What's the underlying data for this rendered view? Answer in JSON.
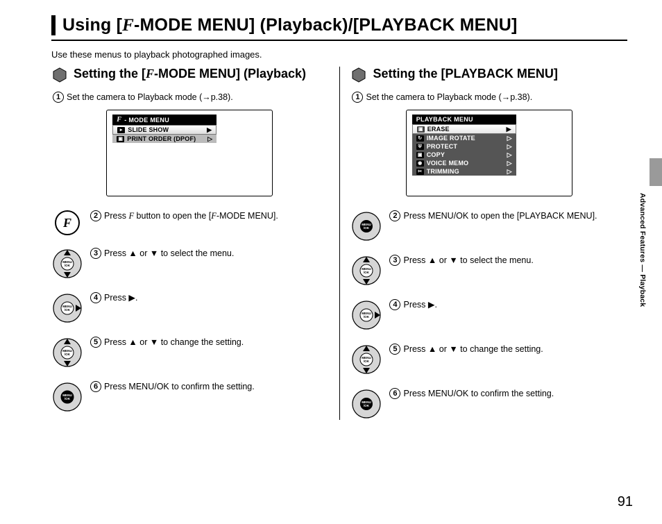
{
  "title_part1": "Using [",
  "title_f": "F",
  "title_part2": "-MODE MENU] (Playback)/[PLAYBACK MENU]",
  "intro": "Use these menus to playback photographed images.",
  "side_label": "Advanced Features — Playback",
  "page_number": "91",
  "left": {
    "heading_part1": "Setting the [",
    "heading_f": "F",
    "heading_part2": "-MODE MENU] (Playback)",
    "step1_num": "1",
    "step1_text": "Set the camera to Playback mode (→p.38).",
    "lcd": {
      "header_f": "F",
      "header_rest": "- MODE MENU",
      "row1_label": "SLIDE SHOW",
      "row2_label": "PRINT ORDER (DPOF)"
    },
    "steps": [
      {
        "num": "2",
        "pre": "Press ",
        "f": "F",
        "post": " button to open the [",
        "f2": "F",
        "post2": "-MODE MENU]."
      },
      {
        "num": "3",
        "text": "Press ▲ or ▼ to select the menu."
      },
      {
        "num": "4",
        "text": "Press ▶."
      },
      {
        "num": "5",
        "text": "Press ▲ or ▼ to change the setting."
      },
      {
        "num": "6",
        "text": "Press MENU/OK to confirm the setting."
      }
    ]
  },
  "right": {
    "heading": "Setting the [PLAYBACK MENU]",
    "step1_num": "1",
    "step1_text": "Set the camera to Playback mode (→p.38).",
    "lcd": {
      "header": "PLAYBACK MENU",
      "rows": [
        "ERASE",
        "IMAGE ROTATE",
        "PROTECT",
        "COPY",
        "VOICE MEMO",
        "TRIMMING"
      ]
    },
    "steps": [
      {
        "num": "2",
        "text": "Press MENU/OK to open the [PLAYBACK MENU]."
      },
      {
        "num": "3",
        "text": "Press ▲ or ▼ to select the menu."
      },
      {
        "num": "4",
        "text": "Press ▶."
      },
      {
        "num": "5",
        "text": "Press ▲ or ▼ to change the setting."
      },
      {
        "num": "6",
        "text": "Press MENU/OK to confirm the setting."
      }
    ]
  }
}
